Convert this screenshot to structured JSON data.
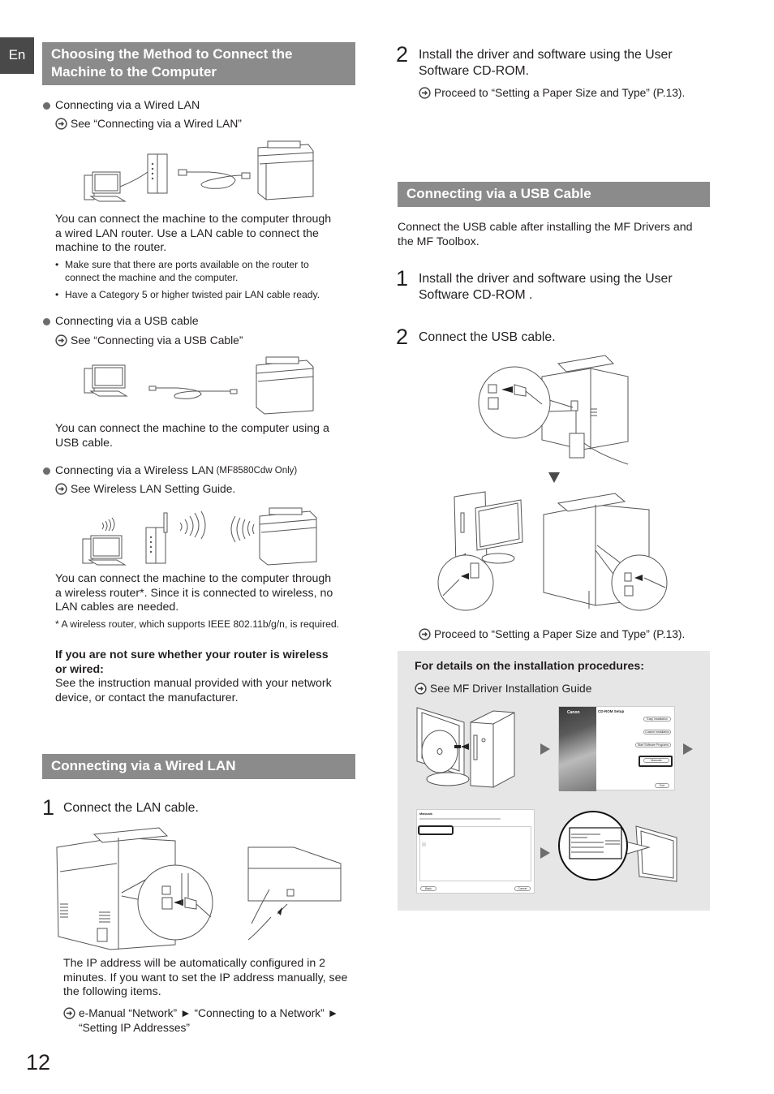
{
  "page": {
    "language_tab": "En",
    "page_number": "12"
  },
  "icons": {
    "reference": "circle-arrow-right-icon",
    "bullet": "filled-circle-bullet",
    "step_arrow": "triangle-down-icon",
    "flow_arrow": "triangle-right-icon"
  },
  "colors": {
    "section_header_bg": "#8c8b8b",
    "language_tab_bg": "#4a4949",
    "info_box_bg": "#e6e6e6",
    "text": "#231f20"
  },
  "choosing_section": {
    "title_line1": "Choosing the Method to Connect the",
    "title_line2": "Machine to the Computer",
    "wired": {
      "label": "Connecting via a Wired LAN",
      "reference": "See “Connecting via a Wired LAN”",
      "description_lines": [
        "You can connect the machine to the computer through",
        "a wired LAN router. Use a LAN cable to connect the",
        "machine to the router."
      ],
      "notes": [
        {
          "line1": "Make sure that there are ports available on the router to",
          "line2": "connect the machine and the computer."
        },
        {
          "line1": "Have a Category 5 or higher twisted pair LAN cable ready.",
          "line2": ""
        }
      ]
    },
    "usb": {
      "label": "Connecting via a USB cable",
      "reference": "See “Connecting via a USB Cable”",
      "description_lines": [
        "You can connect the machine to the computer using a",
        "USB cable."
      ]
    },
    "wireless": {
      "label": "Connecting via a Wireless LAN",
      "label_suffix": "(MF8580Cdw Only)",
      "reference": "See Wireless LAN Setting Guide.",
      "description_lines": [
        "You can connect the machine to the computer through",
        "a wireless router*. Since it is connected to wireless, no",
        "LAN cables are needed."
      ],
      "footnote": "* A wireless router, which supports IEEE 802.11b/g/n, is required."
    },
    "unsure": {
      "heading_line1": "If you are not sure whether your router is wireless",
      "heading_line2": "or wired:",
      "text_line1": "See the instruction manual provided with your network",
      "text_line2": "device, or contact the manufacturer."
    }
  },
  "wired_section": {
    "title": "Connecting via a Wired LAN",
    "step1": {
      "number": "1",
      "text": "Connect the LAN cable."
    },
    "ip_note_lines": [
      "The IP address will be automatically configured in 2",
      "minutes. If you want to set the IP address manually, see",
      "the following items."
    ],
    "reference_line1": "e-Manual “Network” ► “Connecting to a Network” ►",
    "reference_line2": "“Setting IP Addresses”"
  },
  "wired_step2": {
    "number": "2",
    "text_line1": "Install the driver and software using the User",
    "text_line2": "Software CD-ROM.",
    "reference": "Proceed to “Setting a Paper Size and Type” (P.13)."
  },
  "usb_section": {
    "title": "Connecting via a USB Cable",
    "intro_line1": "Connect the USB cable after installing the MF Drivers and",
    "intro_line2": "the MF Toolbox.",
    "step1": {
      "number": "1",
      "text_line1": "Install the driver and software using the User",
      "text_line2": "Software CD-ROM ."
    },
    "step2": {
      "number": "2",
      "text": "Connect the USB cable."
    },
    "reference": "Proceed to “Setting a Paper Size and Type” (P.13)."
  },
  "info_box": {
    "heading": "For details on the installation procedures:",
    "reference": "See MF Driver Installation Guide",
    "setup_screen": {
      "brand": "Canon",
      "title": "CD-ROM Setup",
      "buttons": [
        "Easy Installation",
        "Custom Installation",
        "Start Software Programs",
        "Manuals",
        "Exit"
      ]
    },
    "manuals_screen": {
      "title": "Manuals",
      "buttons": [
        "Back",
        "Cancel"
      ]
    }
  }
}
